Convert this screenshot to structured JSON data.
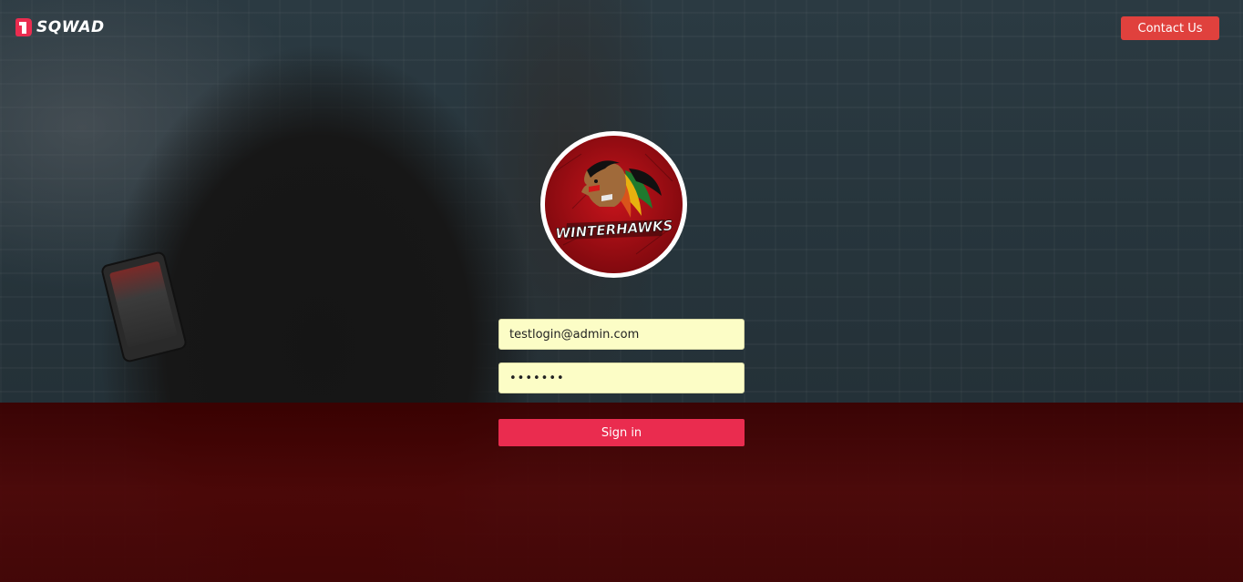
{
  "app": {
    "brand_name": "SQWAD"
  },
  "header": {
    "contact_label": "Contact Us"
  },
  "team_logo": {
    "wordmark": "WINTERHAWKS"
  },
  "login_form": {
    "email_value": "testlogin@admin.com",
    "password_value": "•••••••",
    "signin_label": "Sign in"
  },
  "colors": {
    "contact_button": "#e0413d",
    "signin_button": "#ea2c4f",
    "input_background": "#fcfdc6",
    "team_red": "#a30e14"
  },
  "icons": {
    "brand": "sqwad-logo-icon",
    "team": "winterhawks-logo"
  }
}
